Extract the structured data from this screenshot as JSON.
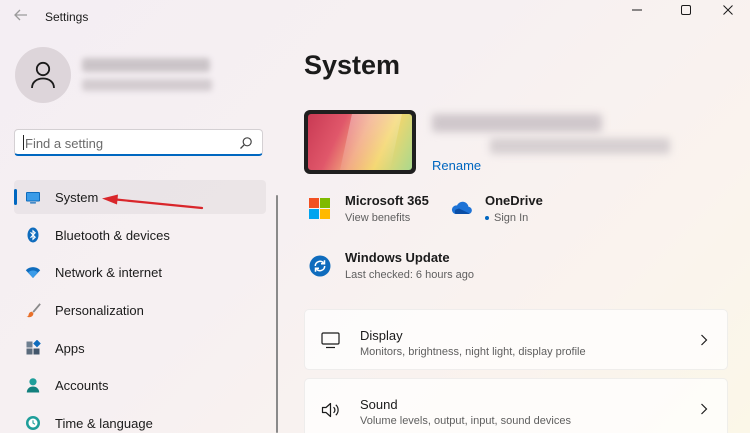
{
  "window": {
    "title": "Settings",
    "back_icon": "back-arrow-icon",
    "minimize_icon": "minimize-icon",
    "maximize_icon": "maximize-icon",
    "close_icon": "close-icon"
  },
  "profile": {
    "avatar_icon": "person-icon"
  },
  "search": {
    "placeholder": "Find a setting",
    "icon": "search-icon"
  },
  "sidebar": {
    "items": [
      {
        "label": "System",
        "icon": "monitor-icon",
        "selected": true
      },
      {
        "label": "Bluetooth & devices",
        "icon": "bluetooth-icon",
        "selected": false
      },
      {
        "label": "Network & internet",
        "icon": "wifi-icon",
        "selected": false
      },
      {
        "label": "Personalization",
        "icon": "brush-icon",
        "selected": false
      },
      {
        "label": "Apps",
        "icon": "apps-icon",
        "selected": false
      },
      {
        "label": "Accounts",
        "icon": "accounts-icon",
        "selected": false
      },
      {
        "label": "Time & language",
        "icon": "globe-clock-icon",
        "selected": false
      }
    ]
  },
  "main": {
    "title": "System",
    "device": {
      "rename_label": "Rename"
    },
    "quick_links": [
      {
        "title": "Microsoft 365",
        "subtitle": "View benefits",
        "icon": "microsoft-logo-icon"
      },
      {
        "title": "OneDrive",
        "subtitle": "Sign In",
        "icon": "cloud-icon"
      },
      {
        "title": "Windows Update",
        "subtitle": "Last checked: 6 hours ago",
        "icon": "sync-icon"
      }
    ],
    "cards": [
      {
        "title": "Display",
        "subtitle": "Monitors, brightness, night light, display profile",
        "icon": "display-icon"
      },
      {
        "title": "Sound",
        "subtitle": "Volume levels, output, input, sound devices",
        "icon": "speaker-icon"
      }
    ]
  },
  "colors": {
    "accent": "#0067c0",
    "annotation_arrow": "#d9262b"
  }
}
